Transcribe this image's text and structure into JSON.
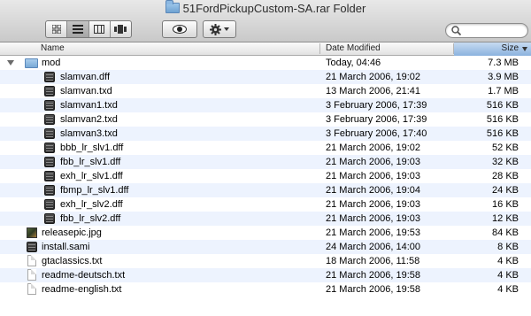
{
  "window": {
    "title": "51FordPickupCustom-SA.rar Folder"
  },
  "toolbar": {
    "view_buttons": [
      "icon-view",
      "list-view",
      "column-view",
      "coverflow-view"
    ],
    "active_view": "list-view",
    "quicklook_icon": "eye-icon",
    "action_icon": "gear-icon",
    "search_placeholder": ""
  },
  "columns": {
    "name": "Name",
    "date": "Date Modified",
    "size": "Size"
  },
  "colors": {
    "alt_row": "#edf3fe",
    "sorted_header": "#a9c6e8"
  },
  "rows": [
    {
      "name": "mod",
      "date": "Today, 04:46",
      "size": "7.3 MB",
      "kind": "folder"
    },
    {
      "name": "slamvan.dff",
      "date": "21 March 2006, 19:02",
      "size": "3.9 MB",
      "kind": "bin"
    },
    {
      "name": "slamvan.txd",
      "date": "13 March 2006, 21:41",
      "size": "1.7 MB",
      "kind": "bin"
    },
    {
      "name": "slamvan1.txd",
      "date": "3 February 2006, 17:39",
      "size": "516 KB",
      "kind": "bin"
    },
    {
      "name": "slamvan2.txd",
      "date": "3 February 2006, 17:39",
      "size": "516 KB",
      "kind": "bin"
    },
    {
      "name": "slamvan3.txd",
      "date": "3 February 2006, 17:40",
      "size": "516 KB",
      "kind": "bin"
    },
    {
      "name": "bbb_lr_slv1.dff",
      "date": "21 March 2006, 19:02",
      "size": "52 KB",
      "kind": "bin"
    },
    {
      "name": "fbb_lr_slv1.dff",
      "date": "21 March 2006, 19:03",
      "size": "32 KB",
      "kind": "bin"
    },
    {
      "name": "exh_lr_slv1.dff",
      "date": "21 March 2006, 19:03",
      "size": "28 KB",
      "kind": "bin"
    },
    {
      "name": "fbmp_lr_slv1.dff",
      "date": "21 March 2006, 19:04",
      "size": "24 KB",
      "kind": "bin"
    },
    {
      "name": "exh_lr_slv2.dff",
      "date": "21 March 2006, 19:03",
      "size": "16 KB",
      "kind": "bin"
    },
    {
      "name": "fbb_lr_slv2.dff",
      "date": "21 March 2006, 19:03",
      "size": "12 KB",
      "kind": "bin"
    },
    {
      "name": "releasepic.jpg",
      "date": "21 March 2006, 19:53",
      "size": "84 KB",
      "kind": "img"
    },
    {
      "name": "install.sami",
      "date": "24 March 2006, 14:00",
      "size": "8 KB",
      "kind": "bin"
    },
    {
      "name": "gtaclassics.txt",
      "date": "18 March 2006, 11:58",
      "size": "4 KB",
      "kind": "doc"
    },
    {
      "name": "readme-deutsch.txt",
      "date": "21 March 2006, 19:58",
      "size": "4 KB",
      "kind": "doc"
    },
    {
      "name": "readme-english.txt",
      "date": "21 March 2006, 19:58",
      "size": "4 KB",
      "kind": "doc"
    }
  ]
}
